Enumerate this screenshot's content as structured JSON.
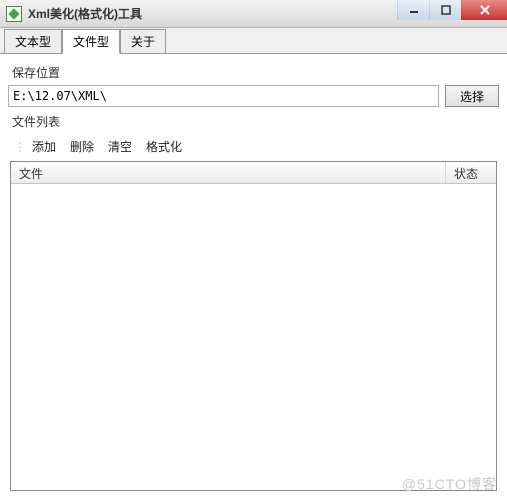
{
  "window": {
    "title": "Xml美化(格式化)工具"
  },
  "tabs": [
    {
      "label": "文本型",
      "active": false
    },
    {
      "label": "文件型",
      "active": true
    },
    {
      "label": "关于",
      "active": false
    }
  ],
  "save": {
    "label": "保存位置",
    "path_value": "E:\\12.07\\XML\\",
    "choose": "选择"
  },
  "file_list": {
    "label": "文件列表",
    "toolbar": {
      "add": "添加",
      "remove": "删除",
      "clear": "清空",
      "format": "格式化"
    },
    "columns": {
      "file": "文件",
      "status": "状态"
    },
    "rows": []
  },
  "watermark": "@51CTO博客"
}
